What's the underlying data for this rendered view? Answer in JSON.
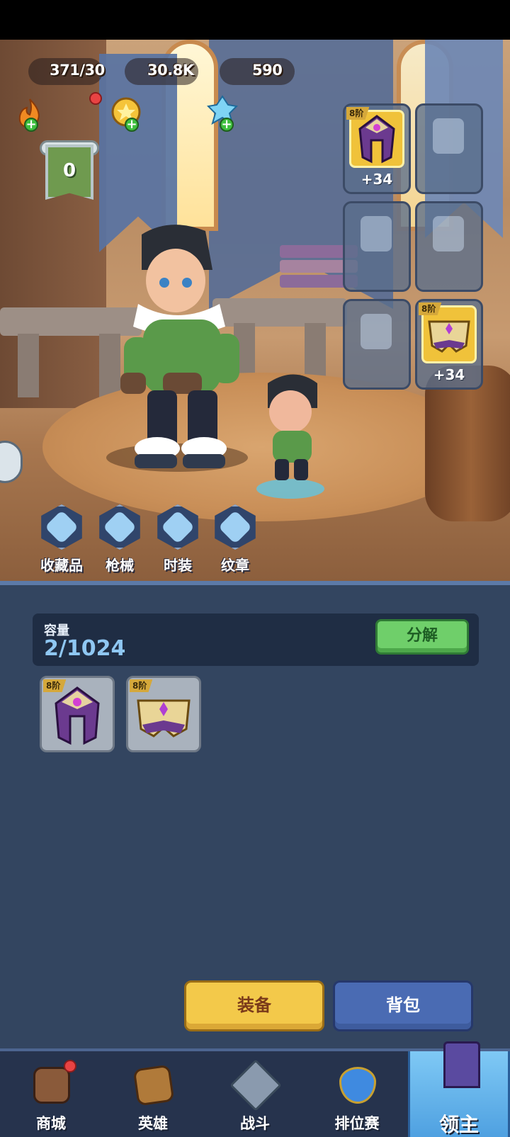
{
  "top_bar": {
    "stamina": {
      "value": "371/30",
      "icon": "flame-icon"
    },
    "gold": {
      "value": "30.8K",
      "icon": "gold-coin-icon"
    },
    "crystals": {
      "value": "590",
      "icon": "blue-crystal-icon"
    }
  },
  "rank": {
    "value": "0"
  },
  "equipment_slots": [
    {
      "slot": "helmet",
      "filled": true,
      "tier": "8阶",
      "bonus": "+34"
    },
    {
      "slot": "armor",
      "filled": false
    },
    {
      "slot": "boots",
      "filled": false
    },
    {
      "slot": "gloves",
      "filled": false
    },
    {
      "slot": "pants",
      "filled": false
    },
    {
      "slot": "belt",
      "filled": true,
      "tier": "8阶",
      "bonus": "+34"
    }
  ],
  "shortcuts": [
    {
      "label": "收藏品",
      "icon": "feather-icon"
    },
    {
      "label": "枪械",
      "icon": "gun-icon"
    },
    {
      "label": "时装",
      "icon": "costume-icon"
    },
    {
      "label": "纹章",
      "icon": "emblem-icon"
    }
  ],
  "inventory": {
    "capacity_label": "容量",
    "capacity_value": "2/1024",
    "decompose_label": "分解",
    "items": [
      {
        "tier": "8阶",
        "icon": "purple-helmet-icon"
      },
      {
        "tier": "8阶",
        "icon": "gold-belt-icon"
      }
    ]
  },
  "actions": {
    "equip_label": "装备",
    "bag_label": "背包"
  },
  "bottom_nav": [
    {
      "label": "商城",
      "icon": "shop-icon",
      "active": false
    },
    {
      "label": "英雄",
      "icon": "hero-card-icon",
      "active": false
    },
    {
      "label": "战斗",
      "icon": "crossed-weapons-icon",
      "active": false
    },
    {
      "label": "排位赛",
      "icon": "ranked-shield-icon",
      "active": false
    },
    {
      "label": "领主",
      "icon": "lord-banner-icon",
      "active": true
    }
  ],
  "colors": {
    "accent_gold": "#f3c94a",
    "accent_blue": "#4a6bb3",
    "panel": "#334560",
    "decompose_green": "#6fcf6a"
  }
}
